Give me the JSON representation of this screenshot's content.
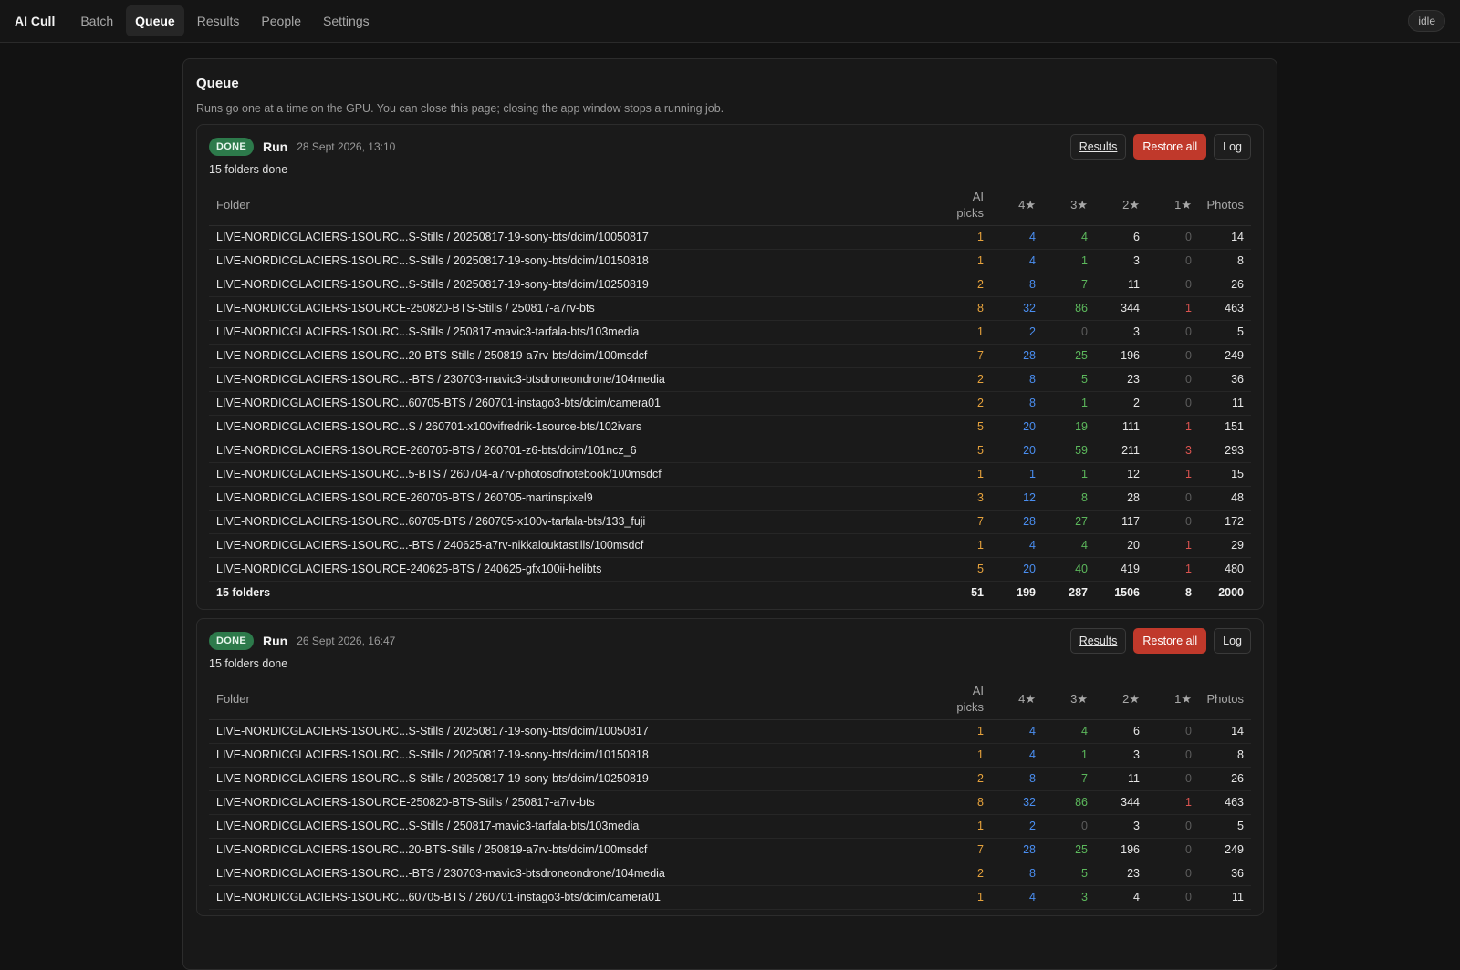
{
  "app": {
    "brand": "AI Cull",
    "nav": [
      "Batch",
      "Queue",
      "Results",
      "People",
      "Settings"
    ],
    "active_nav": "Queue",
    "status": "idle"
  },
  "queue": {
    "title": "Queue",
    "description": "Runs go one at a time on the GPU. You can close this page; closing the app window stops a running job."
  },
  "columns": {
    "folder": "Folder",
    "picks": "AI picks",
    "s4": "4★",
    "s3": "3★",
    "s2": "2★",
    "s1": "1★",
    "photos": "Photos"
  },
  "buttons": {
    "results": "Results",
    "restore": "Restore all",
    "log": "Log"
  },
  "runs": [
    {
      "status": "DONE",
      "label": "Run",
      "date": "28 Sept 2026, 13:10",
      "summary": "15 folders done",
      "rows": [
        [
          "LIVE-NORDICGLACIERS-1SOURC...S-Stills / 20250817-19-sony-bts/dcim/10050817",
          1,
          4,
          4,
          6,
          0,
          14
        ],
        [
          "LIVE-NORDICGLACIERS-1SOURC...S-Stills / 20250817-19-sony-bts/dcim/10150818",
          1,
          4,
          1,
          3,
          0,
          8
        ],
        [
          "LIVE-NORDICGLACIERS-1SOURC...S-Stills / 20250817-19-sony-bts/dcim/10250819",
          2,
          8,
          7,
          11,
          0,
          26
        ],
        [
          "LIVE-NORDICGLACIERS-1SOURCE-250820-BTS-Stills / 250817-a7rv-bts",
          8,
          32,
          86,
          344,
          1,
          463
        ],
        [
          "LIVE-NORDICGLACIERS-1SOURC...S-Stills / 250817-mavic3-tarfala-bts/103media",
          1,
          2,
          0,
          3,
          0,
          5
        ],
        [
          "LIVE-NORDICGLACIERS-1SOURC...20-BTS-Stills / 250819-a7rv-bts/dcim/100msdcf",
          7,
          28,
          25,
          196,
          0,
          249
        ],
        [
          "LIVE-NORDICGLACIERS-1SOURC...-BTS / 230703-mavic3-btsdroneondrone/104media",
          2,
          8,
          5,
          23,
          0,
          36
        ],
        [
          "LIVE-NORDICGLACIERS-1SOURC...60705-BTS / 260701-instago3-bts/dcim/camera01",
          2,
          8,
          1,
          2,
          0,
          11
        ],
        [
          "LIVE-NORDICGLACIERS-1SOURC...S / 260701-x100vifredrik-1source-bts/102ivars",
          5,
          20,
          19,
          111,
          1,
          151
        ],
        [
          "LIVE-NORDICGLACIERS-1SOURCE-260705-BTS / 260701-z6-bts/dcim/101ncz_6",
          5,
          20,
          59,
          211,
          3,
          293
        ],
        [
          "LIVE-NORDICGLACIERS-1SOURC...5-BTS / 260704-a7rv-photosofnotebook/100msdcf",
          1,
          1,
          1,
          12,
          1,
          15
        ],
        [
          "LIVE-NORDICGLACIERS-1SOURCE-260705-BTS / 260705-martinspixel9",
          3,
          12,
          8,
          28,
          0,
          48
        ],
        [
          "LIVE-NORDICGLACIERS-1SOURC...60705-BTS / 260705-x100v-tarfala-bts/133_fuji",
          7,
          28,
          27,
          117,
          0,
          172
        ],
        [
          "LIVE-NORDICGLACIERS-1SOURC...-BTS / 240625-a7rv-nikkalouktastills/100msdcf",
          1,
          4,
          4,
          20,
          1,
          29
        ],
        [
          "LIVE-NORDICGLACIERS-1SOURCE-240625-BTS / 240625-gfx100ii-helibts",
          5,
          20,
          40,
          419,
          1,
          480
        ]
      ],
      "total": [
        "15 folders",
        51,
        199,
        287,
        1506,
        8,
        2000
      ]
    },
    {
      "status": "DONE",
      "label": "Run",
      "date": "26 Sept 2026, 16:47",
      "summary": "15 folders done",
      "rows": [
        [
          "LIVE-NORDICGLACIERS-1SOURC...S-Stills / 20250817-19-sony-bts/dcim/10050817",
          1,
          4,
          4,
          6,
          0,
          14
        ],
        [
          "LIVE-NORDICGLACIERS-1SOURC...S-Stills / 20250817-19-sony-bts/dcim/10150818",
          1,
          4,
          1,
          3,
          0,
          8
        ],
        [
          "LIVE-NORDICGLACIERS-1SOURC...S-Stills / 20250817-19-sony-bts/dcim/10250819",
          2,
          8,
          7,
          11,
          0,
          26
        ],
        [
          "LIVE-NORDICGLACIERS-1SOURCE-250820-BTS-Stills / 250817-a7rv-bts",
          8,
          32,
          86,
          344,
          1,
          463
        ],
        [
          "LIVE-NORDICGLACIERS-1SOURC...S-Stills / 250817-mavic3-tarfala-bts/103media",
          1,
          2,
          0,
          3,
          0,
          5
        ],
        [
          "LIVE-NORDICGLACIERS-1SOURC...20-BTS-Stills / 250819-a7rv-bts/dcim/100msdcf",
          7,
          28,
          25,
          196,
          0,
          249
        ],
        [
          "LIVE-NORDICGLACIERS-1SOURC...-BTS / 230703-mavic3-btsdroneondrone/104media",
          2,
          8,
          5,
          23,
          0,
          36
        ],
        [
          "LIVE-NORDICGLACIERS-1SOURC...60705-BTS / 260701-instago3-bts/dcim/camera01",
          1,
          4,
          3,
          4,
          0,
          11
        ]
      ],
      "total": null
    }
  ]
}
